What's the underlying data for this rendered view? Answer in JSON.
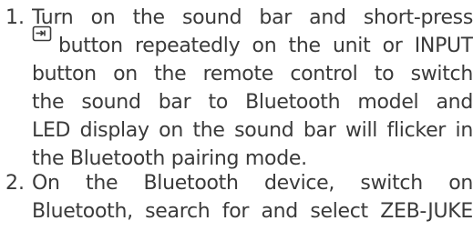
{
  "instructions": {
    "steps": [
      {
        "number": "1.",
        "lines": [
          "Turn on the sound bar and short-press",
          "button repeatedly on the unit or INPUT",
          "button on the remote control to switch",
          "the sound bar to Bluetooth model and",
          "LED display on the sound bar will flicker in",
          "the Bluetooth pairing mode."
        ],
        "icon": "input-source-icon"
      },
      {
        "number": "2.",
        "lines": [
          "On the Bluetooth device, switch on",
          "Bluetooth, search for and select ZEB-JUKE"
        ]
      }
    ]
  }
}
